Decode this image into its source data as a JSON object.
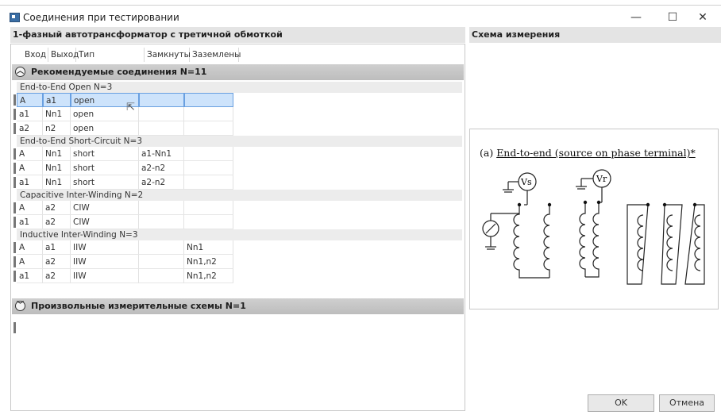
{
  "window": {
    "title": "Соединения при тестировании",
    "minimize": "—",
    "maximize": "☐",
    "close": "✕"
  },
  "left": {
    "header": "1-фазный автотрансформатор с третичной обмоткой",
    "columns": [
      "Вход",
      "Выход",
      "Тип измерения",
      "Замкнуты",
      "Заземлены"
    ],
    "recommended": {
      "label": "Рекомендуемые соединения N=11",
      "groups": [
        {
          "label": "End-to-End Open  N=3",
          "rows": [
            [
              "A",
              "a1",
              "open",
              "",
              ""
            ],
            [
              "a1",
              "Nn1",
              "open",
              "",
              ""
            ],
            [
              "a2",
              "n2",
              "open",
              "",
              ""
            ]
          ]
        },
        {
          "label": "End-to-End Short-Circuit  N=3",
          "rows": [
            [
              "A",
              "Nn1",
              "short",
              "a1-Nn1",
              ""
            ],
            [
              "A",
              "Nn1",
              "short",
              "a2-n2",
              ""
            ],
            [
              "a1",
              "Nn1",
              "short",
              "a2-n2",
              ""
            ]
          ]
        },
        {
          "label": "Capacitive Inter-Winding  N=2",
          "rows": [
            [
              "A",
              "a2",
              "CIW",
              "",
              ""
            ],
            [
              "a1",
              "a2",
              "CIW",
              "",
              ""
            ]
          ]
        },
        {
          "label": "Inductive Inter-Winding  N=3",
          "rows": [
            [
              "A",
              "a1",
              "IIW",
              "",
              "Nn1"
            ],
            [
              "A",
              "a2",
              "IIW",
              "",
              "Nn1,n2"
            ],
            [
              "a1",
              "a2",
              "IIW",
              "",
              "Nn1,n2"
            ]
          ]
        }
      ]
    },
    "custom": {
      "label": "Произвольные измерительные схемы N=1"
    }
  },
  "right": {
    "header": "Схема измерения",
    "diagram_caption_prefix": "(a) ",
    "diagram_caption": "End-to-end (source on phase terminal)*",
    "vs": "Vs",
    "vr": "Vr"
  },
  "buttons": {
    "ok": "OK",
    "cancel": "Отмена"
  }
}
